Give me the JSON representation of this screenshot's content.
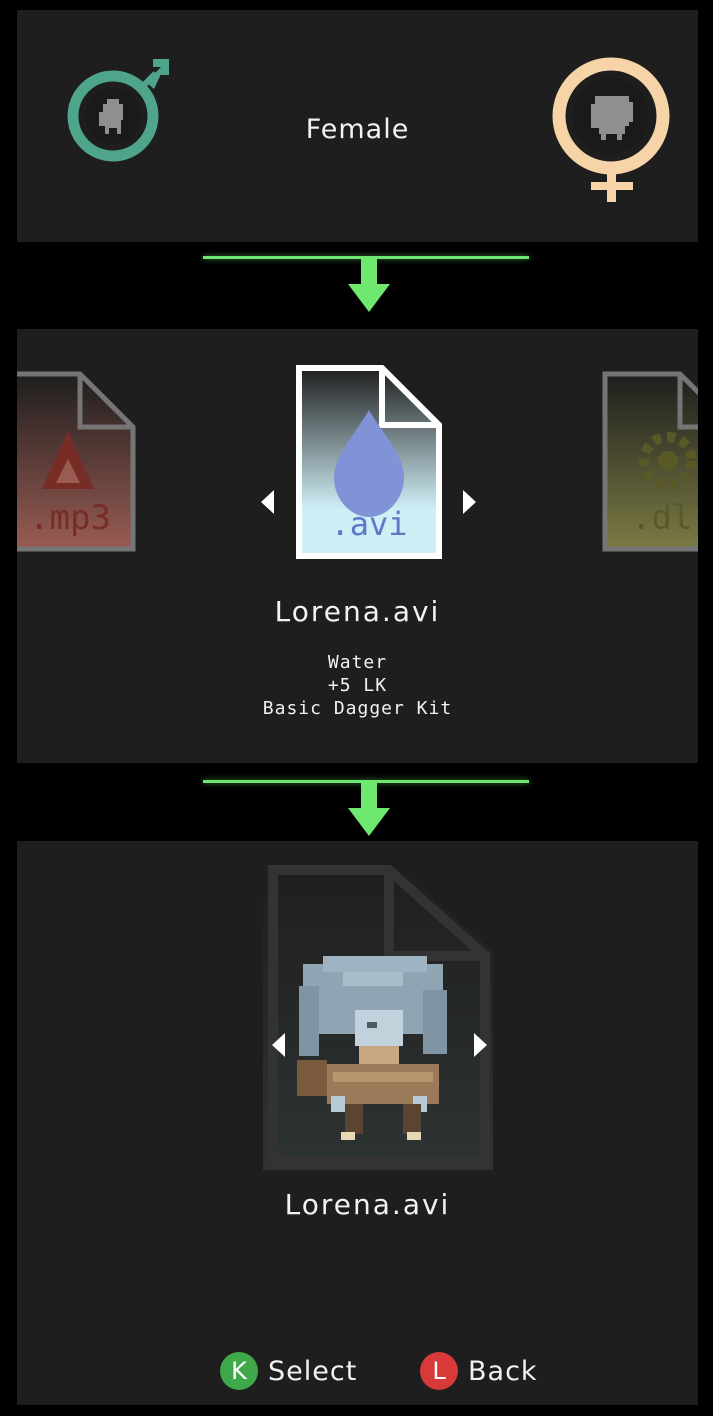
{
  "gender": {
    "label": "Female",
    "male_icon": "male-symbol-icon",
    "female_icon": "female-symbol-icon",
    "male_color": "#4fa58c",
    "female_color": "#f7d4a8"
  },
  "file_select": {
    "left_file": {
      "ext": ".mp3",
      "icon": "flame-icon",
      "color": "#b34236"
    },
    "center_file": {
      "ext": ".avi",
      "icon": "water-drop-icon",
      "color": "#7f93d6"
    },
    "right_file": {
      "ext": ".dll",
      "icon": "gear-icon",
      "color": "#8a8a30"
    },
    "selected_name": "Lorena.avi",
    "details": [
      "Water",
      "+5 LK",
      "Basic Dagger Kit"
    ]
  },
  "preview": {
    "name": "Lorena.avi",
    "portrait_icon": "character-portrait-icon"
  },
  "controls": {
    "select": {
      "key": "K",
      "label": "Select",
      "color": "#3fa84a"
    },
    "back": {
      "key": "L",
      "label": "Back",
      "color": "#d83a3a"
    }
  },
  "accent": "#6ee86e"
}
